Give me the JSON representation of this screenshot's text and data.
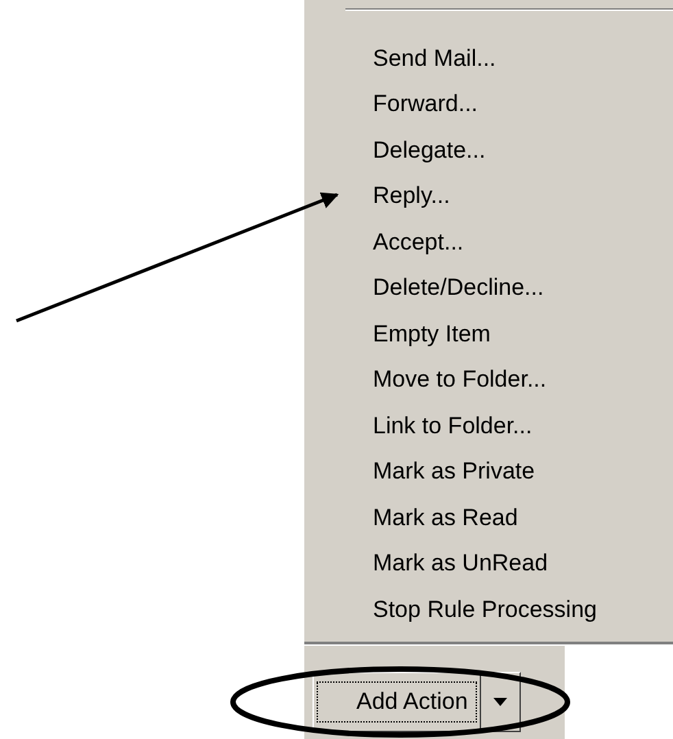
{
  "menu": {
    "items": [
      {
        "label": "Send Mail..."
      },
      {
        "label": "Forward..."
      },
      {
        "label": "Delegate..."
      },
      {
        "label": "Reply..."
      },
      {
        "label": "Accept..."
      },
      {
        "label": "Delete/Decline..."
      },
      {
        "label": "Empty Item"
      },
      {
        "label": "Move to Folder..."
      },
      {
        "label": "Link to Folder..."
      },
      {
        "label": "Mark as Private"
      },
      {
        "label": "Mark as Read"
      },
      {
        "label": "Mark as UnRead"
      },
      {
        "label": "Stop Rule Processing"
      }
    ]
  },
  "add_button": {
    "label": "Add Action",
    "focused": true
  }
}
